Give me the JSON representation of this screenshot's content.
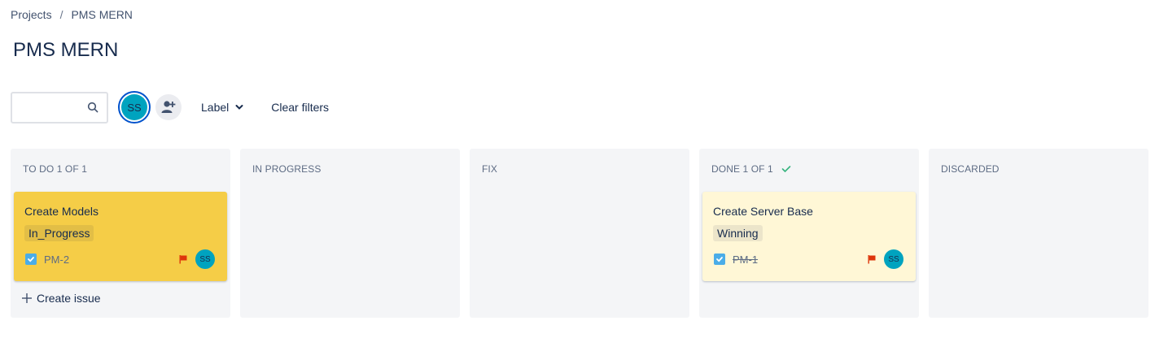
{
  "breadcrumb": {
    "root": "Projects",
    "separator": "/",
    "current": "PMS MERN"
  },
  "page_title": "PMS MERN",
  "filters": {
    "search_value": "",
    "avatar_initials": "SS",
    "label_dropdown": "Label",
    "clear_filters": "Clear filters"
  },
  "colors": {
    "todo_card": "#f5cd47",
    "done_card": "#fff7d6",
    "avatar": "#00a3bf",
    "flag": "#de350b",
    "check": "#4bade8"
  },
  "columns": [
    {
      "title": "TO DO 1 OF 1",
      "card": {
        "summary": "Create Models",
        "tag": "In_Progress",
        "key": "PM-2",
        "assignee": "SS",
        "priority_icon": "flag-icon",
        "type_icon": "task-checkbox-icon"
      },
      "create_issue": "Create issue"
    },
    {
      "title": "IN PROGRESS"
    },
    {
      "title": "FIX"
    },
    {
      "title": "DONE 1 OF 1",
      "done_icon": "check-icon",
      "card": {
        "summary": "Create Server Base",
        "tag": "Winning",
        "key": "PM-1",
        "assignee": "SS",
        "priority_icon": "flag-icon",
        "type_icon": "task-checkbox-icon"
      }
    },
    {
      "title": "DISCARDED"
    }
  ]
}
